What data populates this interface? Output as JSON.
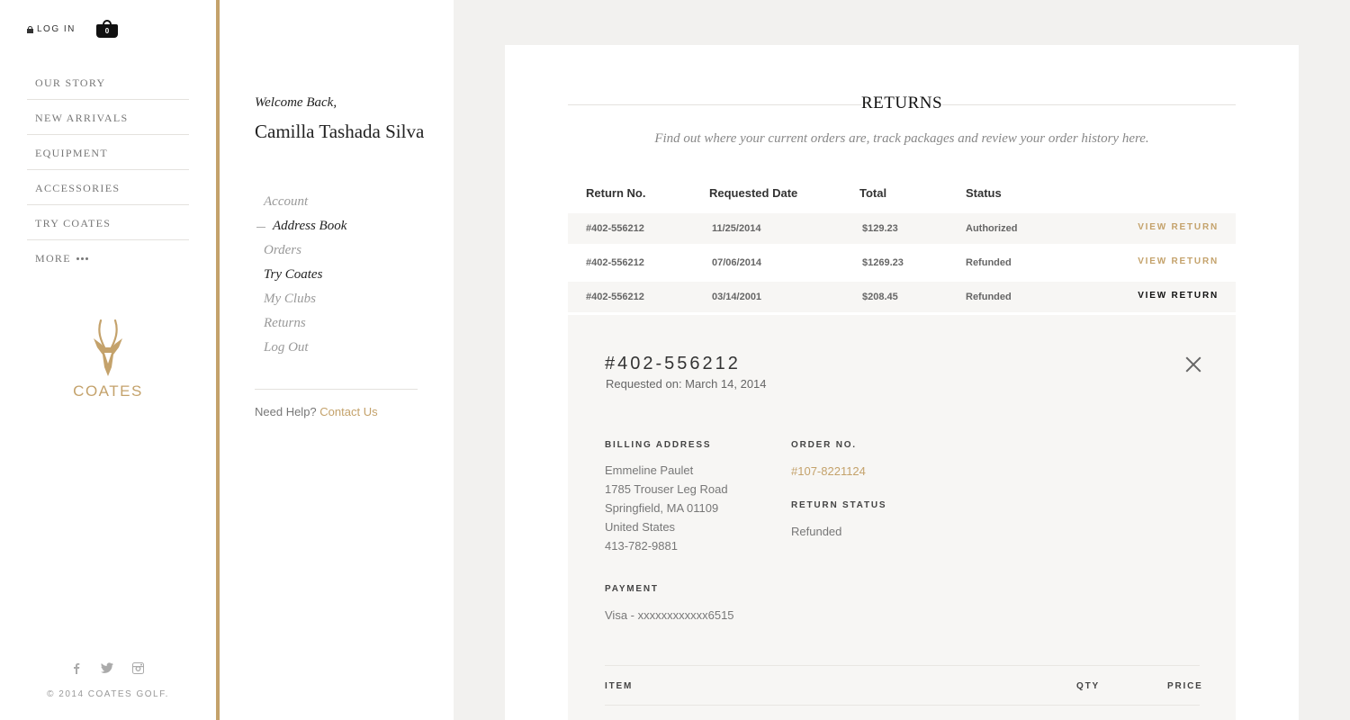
{
  "header": {
    "login_label": "LOG IN",
    "cart_count": "0"
  },
  "main_nav": {
    "items": [
      "OUR STORY",
      "NEW ARRIVALS",
      "EQUIPMENT",
      "ACCESSORIES",
      "TRY COATES"
    ],
    "more_label": "MORE"
  },
  "brand": {
    "logo_text": "COATES",
    "logo_icon": "antelope-head-icon",
    "accent": "#c4a26b"
  },
  "footer": {
    "social_icons": [
      "facebook-icon",
      "twitter-icon",
      "instagram-icon"
    ],
    "copyright": "© 2014 COATES GOLF."
  },
  "account": {
    "welcome": "Welcome Back,",
    "name": "Camilla Tashada Silva",
    "nav": [
      "Account",
      "Address Book",
      "Orders",
      "Try Coates",
      "My Clubs",
      "Returns",
      "Log Out"
    ],
    "active_item": "Address Book",
    "help_text": "Need Help?",
    "help_link": "Contact Us"
  },
  "returns": {
    "title": "RETURNS",
    "subtitle": "Find out where your current orders are, track packages and review your order history here.",
    "columns": [
      "Return No.",
      "Requested Date",
      "Total",
      "Status"
    ],
    "rows": [
      {
        "number": "#402-556212",
        "date": "11/25/2014",
        "total": "$129.23",
        "status": "Authorized",
        "action": "VIEW RETURN"
      },
      {
        "number": "#402-556212",
        "date": "07/06/2014",
        "total": "$1269.23",
        "status": "Refunded",
        "action": "VIEW RETURN"
      },
      {
        "number": "#402-556212",
        "date": "03/14/2001",
        "total": "$208.45",
        "status": "Refunded",
        "action": "VIEW RETURN"
      }
    ]
  },
  "detail": {
    "id": "#402-556212",
    "requested": "Requested on: March 14, 2014",
    "billing_label": "BILLING ADDRESS",
    "billing_lines": [
      "Emmeline Paulet",
      "1785 Trouser Leg Road",
      "Springfield, MA 01109",
      "United States",
      "413-782-9881"
    ],
    "order_label": "ORDER NO.",
    "order_no": "#107-8221124",
    "status_label": "RETURN STATUS",
    "status": "Refunded",
    "payment_label": "PAYMENT",
    "payment": "Visa - xxxxxxxxxxxx6515",
    "items_columns": [
      "ITEM",
      "QTY",
      "PRICE"
    ]
  }
}
